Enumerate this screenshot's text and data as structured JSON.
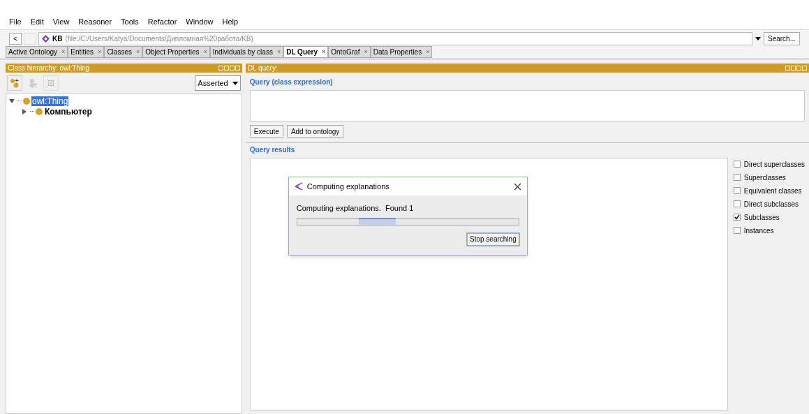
{
  "menu": [
    "File",
    "Edit",
    "View",
    "Reasoner",
    "Tools",
    "Refactor",
    "Window",
    "Help"
  ],
  "address": {
    "back": "<",
    "name": "KB",
    "path": "(file:/C:/Users/Katya/Documents/Дипломная%20работа/KB)",
    "search": "Search..."
  },
  "tabs": [
    {
      "label": "Active Ontology",
      "close": "×",
      "selected": false
    },
    {
      "label": "Entities",
      "close": "×",
      "selected": false
    },
    {
      "label": "Classes",
      "close": "×",
      "selected": false
    },
    {
      "label": "Object Properties",
      "close": "×",
      "selected": false
    },
    {
      "label": "Individuals by class",
      "close": "×",
      "selected": false
    },
    {
      "label": "DL Query",
      "close": "×",
      "selected": true
    },
    {
      "label": "OntoGraf",
      "close": "×",
      "selected": false
    },
    {
      "label": "Data Properties",
      "close": "×",
      "selected": false
    }
  ],
  "class_hierarchy": {
    "title": "Class hierarchy: owl:Thing",
    "mode": "Asserted",
    "tree": [
      {
        "label": "owl:Thing",
        "selected": true,
        "expanded": true,
        "children": [
          {
            "label": "Компьютер",
            "selected": false,
            "expanded": false
          }
        ]
      }
    ]
  },
  "dl_query": {
    "title": "DL query:",
    "query_label": "Query (class expression)",
    "buttons": [
      "Execute",
      "Add to ontology"
    ],
    "results_label": "Query results",
    "options": [
      {
        "label": "Direct superclasses",
        "checked": false
      },
      {
        "label": "Superclasses",
        "checked": false
      },
      {
        "label": "Equivalent classes",
        "checked": false
      },
      {
        "label": "Direct subclasses",
        "checked": false
      },
      {
        "label": "Subclasses",
        "checked": true
      },
      {
        "label": "Instances",
        "checked": false
      }
    ]
  },
  "dialog": {
    "title": "Computing explanations",
    "message": "Computing explanations.  Found 1",
    "button": "Stop searching"
  }
}
